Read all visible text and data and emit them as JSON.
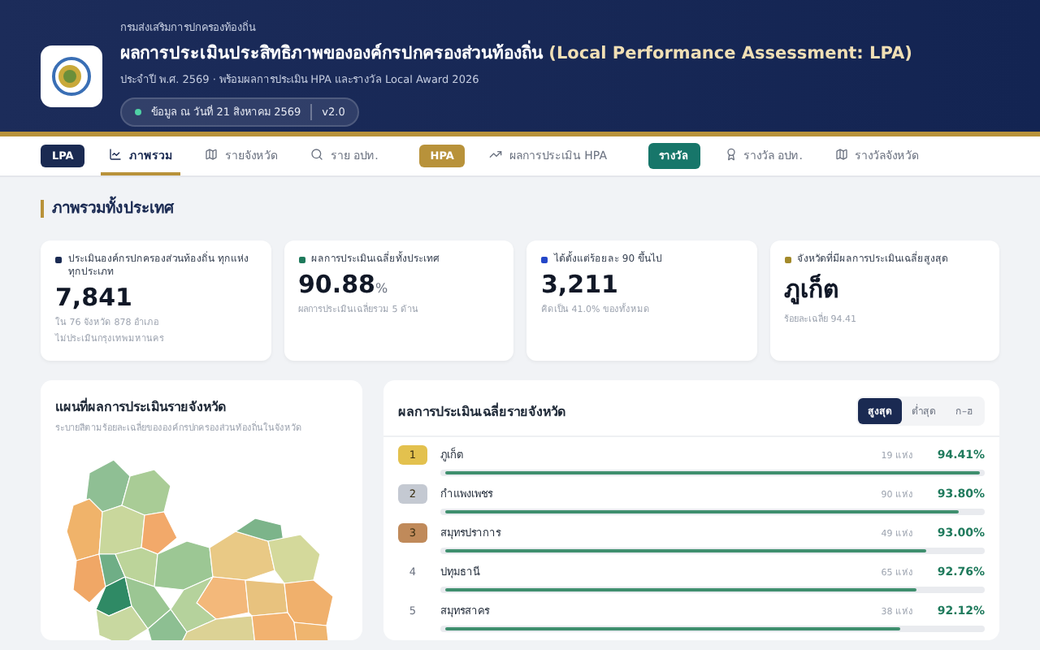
{
  "header": {
    "org": "กรมส่งเสริมการปกครองท้องถิ่น",
    "title": "ผลการประเมินประสิทธิภาพขององค์กรปกครองส่วนท้องถิ่น",
    "title_en": "(Local Performance Assessment: LPA)",
    "subtitle": "ประจำปี พ.ศ. 2569 · พร้อมผลการประเมิน HPA และรางวัล Local Award 2026",
    "data_date": "ข้อมูล ณ วันที่ 21 สิงหาคม 2569",
    "version": "v2.0"
  },
  "nav": [
    {
      "badge": "LPA",
      "color": "#1a2a52",
      "items": [
        {
          "label": "ภาพรวม",
          "selected": true
        },
        {
          "label": "รายจังหวัด",
          "selected": false
        },
        {
          "label": "ราย อปท.",
          "selected": false
        }
      ]
    },
    {
      "badge": "HPA",
      "color": "#b8923a",
      "items": [
        {
          "label": "ผลการประเมิน HPA",
          "selected": false
        }
      ]
    },
    {
      "badge": "รางวัล",
      "color": "#17766a",
      "items": [
        {
          "label": "รางวัล อปท.",
          "selected": false
        },
        {
          "label": "รางวัลจังหวัด",
          "selected": false
        }
      ]
    }
  ],
  "section_title": "ภาพรวมทั้งประเทศ",
  "stats": [
    {
      "label": "ประเมินองค์กรปกครองส่วนท้องถิ่น ทุกแห่งทุกประเภท",
      "color": "#1a2a52",
      "value": "7,841",
      "notes": [
        "ใน 76 จังหวัด 878 อำเภอ",
        "ไม่ประเมินกรุงเทพมหานคร"
      ]
    },
    {
      "label": "ผลการประเมินเฉลี่ยทั้งประเทศ",
      "color": "#1f7a5c",
      "value": "90.88",
      "unit": "%",
      "notes": [
        "ผลการประเมินเฉลี่ยรวม 5 ด้าน"
      ]
    },
    {
      "label": "ได้ตั้งแต่ร้อยละ 90 ขึ้นไป",
      "color": "#2446c8",
      "value": "3,211",
      "notes": [
        "คิดเป็น 41.0% ของทั้งหมด"
      ]
    },
    {
      "label": "จังหวัดที่มีผลการประเมินเฉลี่ยสูงสุด",
      "color": "#a38a2a",
      "value": "ภูเก็ต",
      "notes": [
        "ร้อยละเฉลี่ย 94.41"
      ]
    }
  ],
  "map_panel": {
    "title": "แผนที่ผลการประเมินรายจังหวัด",
    "subtitle": "ระบายสีตามร้อยละเฉลี่ยขององค์กรปกครองส่วนท้องถิ่นในจังหวัด"
  },
  "ranking": {
    "title": "ผลการประเมินเฉลี่ยรายจังหวัด",
    "sorts": [
      {
        "label": "สูงสุด",
        "selected": true
      },
      {
        "label": "ต่ำสุด",
        "selected": false
      },
      {
        "label": "ก–ฮ",
        "selected": false
      }
    ],
    "rows": [
      {
        "rank": "1",
        "color": "#e3c14e",
        "name": "ภูเก็ต",
        "count": "19 แห่ง",
        "score": "94.41%",
        "level": 1.0
      },
      {
        "rank": "2",
        "color": "#c4c9d2",
        "name": "กำแพงเพชร",
        "count": "90 แห่ง",
        "score": "93.80%",
        "level": 0.96
      },
      {
        "rank": "3",
        "color": "#c08a5a",
        "name": "สมุทรปราการ",
        "count": "49 แห่ง",
        "score": "93.00%",
        "level": 0.9
      },
      {
        "rank": "4",
        "name": "ปทุมธานี",
        "count": "65 แห่ง",
        "score": "92.76%",
        "level": 0.88
      },
      {
        "rank": "5",
        "name": "สมุทรสาคร",
        "count": "38 แห่ง",
        "score": "92.12%",
        "level": 0.85
      }
    ]
  }
}
